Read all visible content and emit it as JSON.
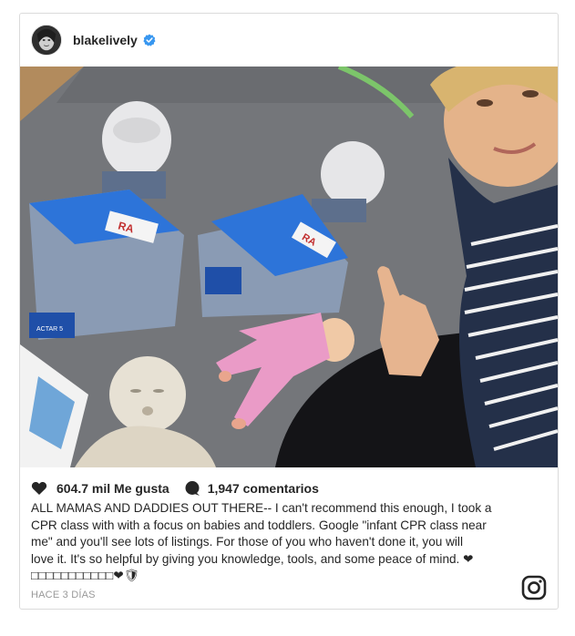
{
  "post": {
    "username": "blakelively",
    "verified": true,
    "likes": "604.7 mil Me gusta",
    "comments": "1,947 comentarios",
    "caption_lines": [
      "ALL MAMAS AND DADDIES OUT THERE-- I can't recommend this enough, I took a",
      "CPR class with with a focus on babies and toddlers. Google \"infant CPR class near",
      "me\" and you'll see lots of listings. For those of you who haven't done it, you will",
      "love it. It's so helpful by giving you knowledge, tools, and some peace of mind. ❤",
      "□□□□□□□□□□□❤🛡"
    ],
    "time_ago": "HACE 3 DÍAS"
  },
  "icons": {
    "avatar": "avatar-photo",
    "verified": "verified-badge-icon",
    "like": "heart-icon",
    "comment": "comment-bubble-icon",
    "logo": "instagram-logo-icon"
  },
  "colors": {
    "verified": "#3897f0",
    "text": "#262626",
    "muted": "#999999",
    "border": "#dbdbdb"
  },
  "image": {
    "manikin_label_left": "RA",
    "manikin_label_right": "RA",
    "device_label": "ACTAR 5"
  }
}
